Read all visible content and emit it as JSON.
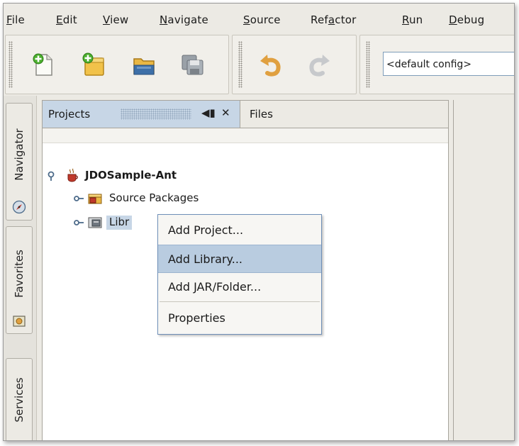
{
  "menubar": {
    "items": [
      {
        "pre": "",
        "key": "F",
        "post": "ile"
      },
      {
        "pre": "",
        "key": "E",
        "post": "dit"
      },
      {
        "pre": "",
        "key": "V",
        "post": "iew"
      },
      {
        "pre": "",
        "key": "N",
        "post": "avigate"
      },
      {
        "pre": "",
        "key": "S",
        "post": "ource"
      },
      {
        "pre": "Ref",
        "key": "a",
        "post": "ctor"
      },
      {
        "pre": "",
        "key": "R",
        "post": "un"
      },
      {
        "pre": "",
        "key": "D",
        "post": "ebug"
      }
    ]
  },
  "toolbar": {
    "buttons": [
      {
        "name": "new-file-icon"
      },
      {
        "name": "new-project-icon"
      },
      {
        "name": "open-project-icon"
      },
      {
        "name": "save-all-icon"
      },
      {
        "name": "undo-icon"
      },
      {
        "name": "redo-icon"
      }
    ],
    "config_value": "<default config>"
  },
  "side_tabs": {
    "navigator": "Navigator",
    "favorites": "Favorites",
    "services": "Services"
  },
  "panel": {
    "tabs": {
      "projects": "Projects",
      "files": "Files",
      "minimize_glyph": "◀▮",
      "close_glyph": "✕"
    },
    "tree": {
      "root": "JDOSample-Ant",
      "source_packages": "Source Packages",
      "libraries_visible": "Libr"
    }
  },
  "context_menu": {
    "items": {
      "add_project": "Add Project...",
      "add_library": "Add Library...",
      "add_jar": "Add JAR/Folder...",
      "properties": "Properties"
    },
    "selected": "Add Library..."
  },
  "colors": {
    "selection": "#b9cce0",
    "active_tab": "#c7d6e6",
    "menu_border": "#6e8fb8"
  }
}
